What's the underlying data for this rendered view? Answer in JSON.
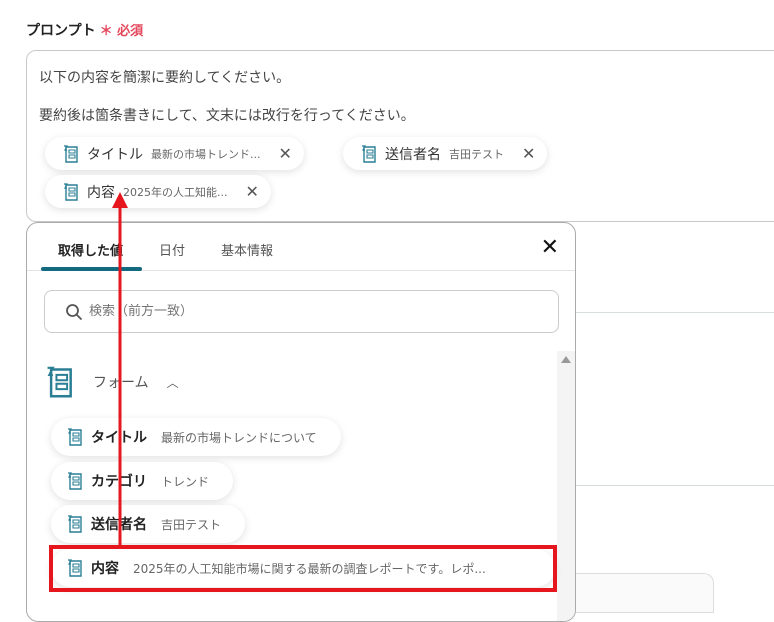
{
  "field": {
    "label": "プロンプト",
    "required_mark": "＊",
    "required_text": "必須"
  },
  "prompt": {
    "line1": "以下の内容を簡潔に要約してください。",
    "line2": "要約後は箇条書きにして、文末には改行を行ってください。",
    "chips": [
      {
        "key": "タイトル",
        "value": "最新の市場トレンド..."
      },
      {
        "key": "送信者名",
        "value": "吉田テスト"
      },
      {
        "key": "内容",
        "value": "2025年の人工知能..."
      }
    ]
  },
  "popup": {
    "tabs": [
      "取得した値",
      "日付",
      "基本情報"
    ],
    "search_placeholder": "検索（前方一致）",
    "section": "フォーム",
    "items": [
      {
        "key": "タイトル",
        "value": "最新の市場トレンドについて"
      },
      {
        "key": "カテゴリ",
        "value": "トレンド"
      },
      {
        "key": "送信者名",
        "value": "吉田テスト"
      },
      {
        "key": "内容",
        "value": "2025年の人工知能市場に関する最新の調査レポートです。レポ..."
      }
    ]
  },
  "colors": {
    "accent": "#13697e",
    "annotation": "#e5161d",
    "required": "#e5485c"
  }
}
